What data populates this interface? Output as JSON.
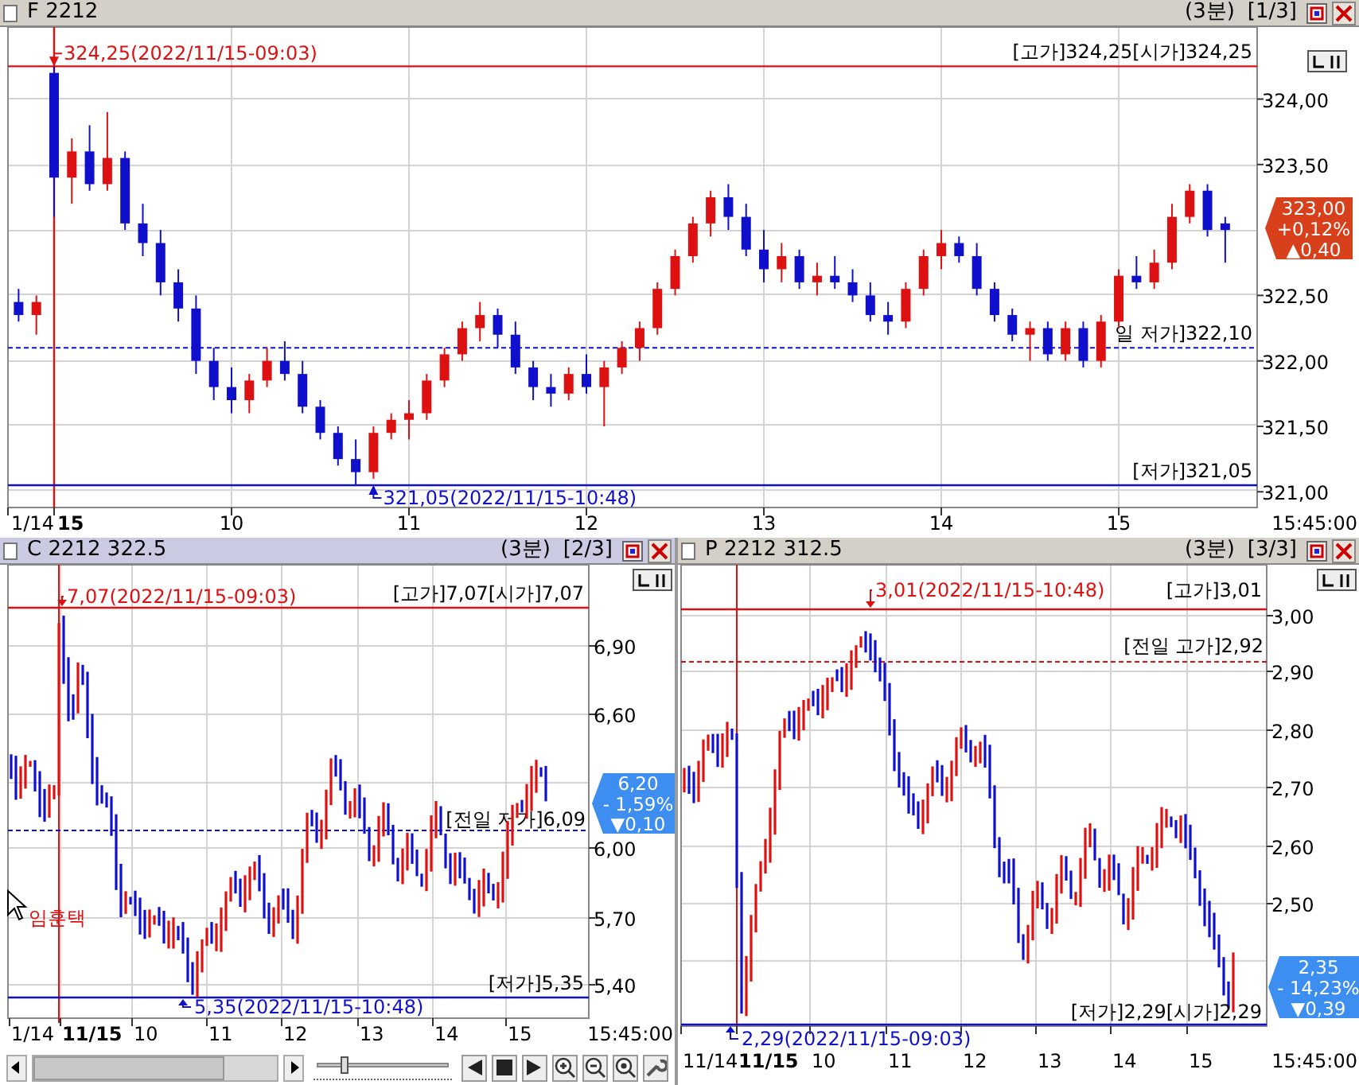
{
  "panels": [
    {
      "kind": "candle",
      "selected": false,
      "title": "F 2212",
      "timeframe": "(3분)",
      "page": "[1/3]",
      "chart_data": {
        "type": "candlestick",
        "grid": true,
        "ylim": [
          320.88,
          324.55
        ],
        "xlim": [
          8.74,
          15.78
        ],
        "yticks": [
          {
            "value": 324,
            "label": "324,00"
          },
          {
            "value": 323.5,
            "label": "323,50"
          },
          {
            "value": 322.5,
            "label": "322,50"
          },
          {
            "value": 322,
            "label": "322,00"
          },
          {
            "value": 321.5,
            "label": "321,50"
          },
          {
            "value": 321,
            "label": "321,00"
          }
        ],
        "xticks": [
          10,
          11,
          12,
          13,
          14,
          15
        ],
        "annotations": [
          {
            "x": 9,
            "y": 324.25,
            "text": "324,25(2022/11/15-09:03)"
          },
          {
            "x": 10.8,
            "y": 321.05,
            "text": "321,05(2022/11/15-10:48)"
          }
        ],
        "ref_lines": [
          {
            "axis": "x",
            "value": 9,
            "color": "#dd1111"
          },
          {
            "axis": "y",
            "value": 324.25,
            "color": "#dd1111",
            "label": "[고가]324,25[시가]324,25"
          },
          {
            "axis": "y",
            "value": 321.05,
            "color": "#1010cc",
            "label": "[저가]321,05"
          },
          {
            "axis": "y",
            "value": 322.1,
            "color": "#1010cc",
            "label": "일 저가]322,10"
          }
        ],
        "x": [
          8.8,
          8.9,
          9.0,
          9.1,
          9.2,
          9.3,
          9.4,
          9.5,
          9.6,
          9.7,
          9.8,
          9.9,
          10.0,
          10.1,
          10.2,
          10.3,
          10.4,
          10.5,
          10.6,
          10.7,
          10.8,
          10.9,
          11.0,
          11.1,
          11.2,
          11.3,
          11.4,
          11.5,
          11.6,
          11.7,
          11.8,
          11.9,
          12.0,
          12.1,
          12.2,
          12.3,
          12.4,
          12.5,
          12.6,
          12.7,
          12.8,
          12.9,
          13.0,
          13.1,
          13.2,
          13.3,
          13.4,
          13.5,
          13.6,
          13.7,
          13.8,
          13.9,
          14.0,
          14.1,
          14.2,
          14.3,
          14.4,
          14.5,
          14.6,
          14.7,
          14.8,
          14.9,
          15.0,
          15.1,
          15.2,
          15.3,
          15.4,
          15.5,
          15.6
        ],
        "ohlc": [
          [
            322.45,
            322.55,
            322.3,
            322.35
          ],
          [
            322.35,
            322.5,
            322.2,
            322.45
          ],
          [
            324.2,
            324.25,
            323.1,
            323.4
          ],
          [
            323.4,
            323.7,
            323.2,
            323.6
          ],
          [
            323.6,
            323.8,
            323.3,
            323.35
          ],
          [
            323.35,
            323.9,
            323.3,
            323.55
          ],
          [
            323.55,
            323.6,
            323.0,
            323.05
          ],
          [
            323.05,
            323.2,
            322.8,
            322.9
          ],
          [
            322.9,
            323.0,
            322.5,
            322.6
          ],
          [
            322.6,
            322.7,
            322.3,
            322.4
          ],
          [
            322.4,
            322.5,
            321.9,
            322.0
          ],
          [
            322.0,
            322.1,
            321.7,
            321.8
          ],
          [
            321.8,
            321.95,
            321.6,
            321.7
          ],
          [
            321.7,
            321.9,
            321.6,
            321.85
          ],
          [
            321.85,
            322.1,
            321.8,
            322.0
          ],
          [
            322.0,
            322.15,
            321.85,
            321.9
          ],
          [
            321.9,
            322.0,
            321.6,
            321.65
          ],
          [
            321.65,
            321.7,
            321.4,
            321.45
          ],
          [
            321.45,
            321.5,
            321.2,
            321.25
          ],
          [
            321.25,
            321.4,
            321.05,
            321.15
          ],
          [
            321.15,
            321.5,
            321.1,
            321.45
          ],
          [
            321.45,
            321.6,
            321.4,
            321.55
          ],
          [
            321.55,
            321.7,
            321.4,
            321.6
          ],
          [
            321.6,
            321.9,
            321.55,
            321.85
          ],
          [
            321.85,
            322.1,
            321.8,
            322.05
          ],
          [
            322.05,
            322.3,
            322.0,
            322.25
          ],
          [
            322.25,
            322.45,
            322.15,
            322.35
          ],
          [
            322.35,
            322.4,
            322.1,
            322.2
          ],
          [
            322.2,
            322.3,
            321.9,
            321.95
          ],
          [
            321.95,
            322.0,
            321.7,
            321.8
          ],
          [
            321.8,
            321.9,
            321.65,
            321.75
          ],
          [
            321.75,
            321.95,
            321.7,
            321.9
          ],
          [
            321.9,
            322.05,
            321.75,
            321.8
          ],
          [
            321.8,
            322.0,
            321.5,
            321.95
          ],
          [
            321.95,
            322.15,
            321.9,
            322.1
          ],
          [
            322.1,
            322.3,
            322.0,
            322.25
          ],
          [
            322.25,
            322.6,
            322.2,
            322.55
          ],
          [
            322.55,
            322.85,
            322.5,
            322.8
          ],
          [
            322.8,
            323.1,
            322.75,
            323.05
          ],
          [
            323.05,
            323.3,
            322.95,
            323.25
          ],
          [
            323.25,
            323.35,
            323.0,
            323.1
          ],
          [
            323.1,
            323.2,
            322.8,
            322.85
          ],
          [
            322.85,
            323.0,
            322.6,
            322.7
          ],
          [
            322.7,
            322.9,
            322.6,
            322.8
          ],
          [
            322.8,
            322.85,
            322.55,
            322.6
          ],
          [
            322.6,
            322.75,
            322.5,
            322.65
          ],
          [
            322.65,
            322.8,
            322.55,
            322.6
          ],
          [
            322.6,
            322.7,
            322.45,
            322.5
          ],
          [
            322.5,
            322.6,
            322.3,
            322.35
          ],
          [
            322.35,
            322.45,
            322.2,
            322.3
          ],
          [
            322.3,
            322.6,
            322.25,
            322.55
          ],
          [
            322.55,
            322.85,
            322.5,
            322.8
          ],
          [
            322.8,
            323.0,
            322.7,
            322.9
          ],
          [
            322.9,
            322.95,
            322.75,
            322.8
          ],
          [
            322.8,
            322.9,
            322.5,
            322.55
          ],
          [
            322.55,
            322.6,
            322.3,
            322.35
          ],
          [
            322.35,
            322.4,
            322.15,
            322.2
          ],
          [
            322.2,
            322.3,
            322.0,
            322.25
          ],
          [
            322.25,
            322.3,
            322.0,
            322.05
          ],
          [
            322.05,
            322.3,
            322.0,
            322.25
          ],
          [
            322.25,
            322.3,
            321.95,
            322.0
          ],
          [
            322.0,
            322.35,
            321.95,
            322.3
          ],
          [
            322.3,
            322.7,
            322.25,
            322.65
          ],
          [
            322.65,
            322.8,
            322.55,
            322.6
          ],
          [
            322.6,
            322.85,
            322.55,
            322.75
          ],
          [
            322.75,
            323.2,
            322.7,
            323.1
          ],
          [
            323.1,
            323.35,
            323.05,
            323.3
          ],
          [
            323.3,
            323.35,
            322.95,
            323.0
          ],
          [
            323.05,
            323.1,
            322.75,
            323.0
          ]
        ]
      },
      "date_labels": [
        {
          "label": "1/14",
          "bold": false
        },
        {
          "label": "15",
          "bold": true
        }
      ],
      "end_time": "15:45:00",
      "badge": {
        "color": "#d8401c",
        "lines": [
          "323,00",
          "+0,12%",
          "▲0,40"
        ]
      }
    },
    {
      "kind": "bar",
      "selected": true,
      "title": "C 2212 322.5",
      "timeframe": "(3분)",
      "page": "[2/3]",
      "y_ticks": [
        "6,90",
        "6,60",
        "6,00",
        "5,70",
        "5,40"
      ],
      "x_ticks": [
        {
          "label": "1/14",
          "bold": false
        },
        {
          "label": "11/15",
          "bold": true
        },
        {
          "label": "10",
          "bold": false
        },
        {
          "label": "11",
          "bold": false
        },
        {
          "label": "12",
          "bold": false
        },
        {
          "label": "13",
          "bold": false
        },
        {
          "label": "14",
          "bold": false
        },
        {
          "label": "15",
          "bold": false
        }
      ],
      "end_time": "15:45:00",
      "high_marker": "7,07(2022/11/15-09:03)",
      "high_label": "[고가]7,07[시가]7,07",
      "low_marker": "5,35(2022/11/15-10:48)",
      "low_label": "[저가]5,35",
      "prev_line": {
        "kind": "low",
        "label": "[전일 저가]6,09"
      },
      "badge": {
        "color": "#3d8ef0",
        "lines": [
          "6,20",
          "- 1,59%",
          "▼0,10"
        ]
      },
      "cursor_label": "임훈택",
      "toolbar": {
        "slider": {
          "level": 0.2
        }
      }
    },
    {
      "kind": "bar",
      "selected": false,
      "title": "P 2212 312.5",
      "timeframe": "(3분)",
      "page": "[3/3]",
      "y_ticks": [
        "3,00",
        "2,90",
        "2,80",
        "2,70",
        "2,60",
        "2,50"
      ],
      "x_ticks": [
        {
          "label": "11/14",
          "bold": false
        },
        {
          "label": "11/15",
          "bold": true
        },
        {
          "label": "10",
          "bold": false
        },
        {
          "label": "11",
          "bold": false
        },
        {
          "label": "12",
          "bold": false
        },
        {
          "label": "13",
          "bold": false
        },
        {
          "label": "14",
          "bold": false
        },
        {
          "label": "15",
          "bold": false
        }
      ],
      "end_time": "15:45:00",
      "high_marker": "3,01(2022/11/15-10:48)",
      "high_label": "[고가]3,01",
      "low_marker": "2,29(2022/11/15-09:03)",
      "low_label": "[저가]2,29[시가]2,29",
      "prev_line": {
        "kind": "high",
        "label": "[전일 고가]2,92"
      },
      "badge": {
        "color": "#3d8ef1",
        "lines": [
          "2,35",
          "- 14,23%",
          "▼0,39"
        ]
      }
    }
  ]
}
